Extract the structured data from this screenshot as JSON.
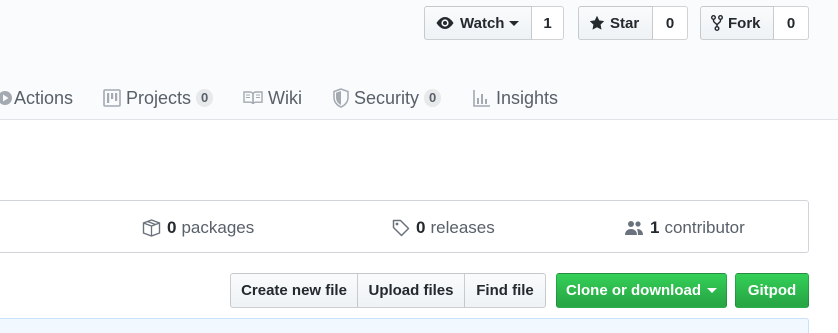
{
  "social": {
    "watch": {
      "label": "Watch",
      "count": "1"
    },
    "star": {
      "label": "Star",
      "count": "0"
    },
    "fork": {
      "label": "Fork",
      "count": "0"
    }
  },
  "tabs": [
    {
      "label": "Actions",
      "icon": "play-icon"
    },
    {
      "label": "Projects",
      "counter": "0",
      "icon": "project-icon"
    },
    {
      "label": "Wiki",
      "icon": "book-icon"
    },
    {
      "label": "Security",
      "counter": "0",
      "icon": "shield-icon"
    },
    {
      "label": "Insights",
      "icon": "graph-icon"
    }
  ],
  "summary": {
    "packages": {
      "count": "0",
      "label": "packages",
      "icon": "package-icon"
    },
    "releases": {
      "count": "0",
      "label": "releases",
      "icon": "tag-icon"
    },
    "contributors": {
      "count": "1",
      "label": "contributor",
      "icon": "people-icon"
    }
  },
  "file_buttons": {
    "create": "Create new file",
    "upload": "Upload files",
    "find": "Find file",
    "clone": "Clone or download",
    "gitpod": "Gitpod"
  },
  "colors": {
    "green": "#28a745",
    "header_bg": "#fafbfc",
    "border": "#e1e4e8"
  }
}
